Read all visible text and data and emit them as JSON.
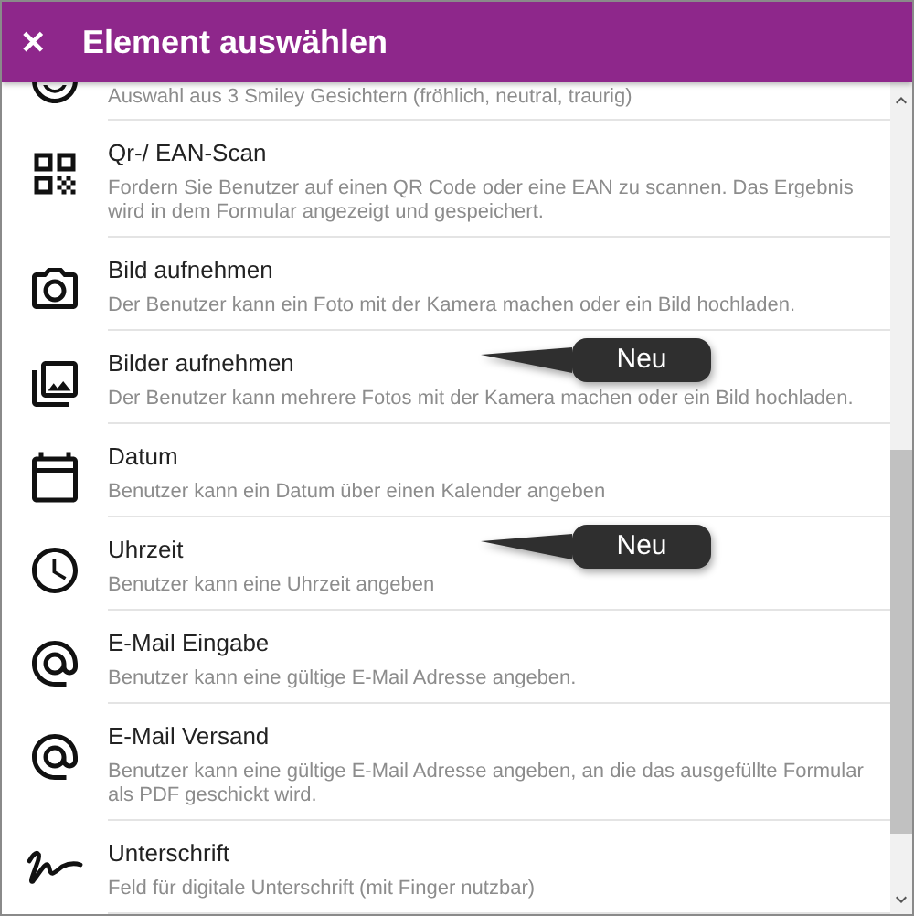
{
  "header": {
    "close": "✕",
    "title": "Element auswählen"
  },
  "items": [
    {
      "kind": "smiley",
      "partial": true,
      "description": "Auswahl aus 3 Smiley Gesichtern (fröhlich, neutral, traurig)"
    },
    {
      "kind": "qr",
      "title": "Qr-/ EAN-Scan",
      "description": "Fordern Sie Benutzer auf einen QR Code oder eine EAN zu scannen. Das Ergebnis wird in dem Formular angezeigt und gespeichert."
    },
    {
      "kind": "camera",
      "title": "Bild aufnehmen",
      "description": "Der Benutzer kann ein Foto mit der Kamera machen oder ein Bild hochladen."
    },
    {
      "kind": "photos",
      "title": "Bilder aufnehmen",
      "description": "Der Benutzer kann mehrere Fotos mit der Kamera machen oder ein Bild hochladen.",
      "badge": "Neu"
    },
    {
      "kind": "calendar",
      "title": "Datum",
      "description": "Benutzer kann ein Datum über einen Kalender angeben"
    },
    {
      "kind": "clock",
      "title": "Uhrzeit",
      "description": "Benutzer kann eine Uhrzeit angeben",
      "badge": "Neu"
    },
    {
      "kind": "at",
      "title": "E-Mail Eingabe",
      "description": "Benutzer kann eine gültige E-Mail Adresse angeben."
    },
    {
      "kind": "at",
      "title": "E-Mail Versand",
      "description": "Benutzer kann eine gültige E-Mail Adresse angeben, an die das ausgefüllte Formular als PDF geschickt wird."
    },
    {
      "kind": "signature",
      "title": "Unterschrift",
      "description": "Feld für digitale Unterschrift (mit Finger nutzbar)"
    }
  ]
}
